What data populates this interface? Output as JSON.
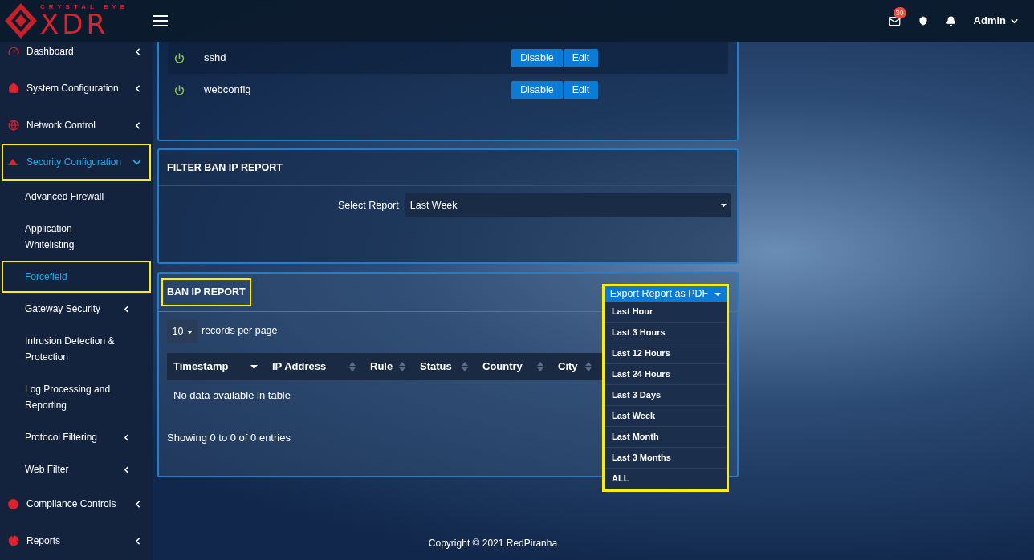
{
  "header": {
    "mail_count": "30",
    "user": "Admin"
  },
  "logo": {
    "tagline": "CRYSTAL EYE",
    "mark": "XDR"
  },
  "sidebar": {
    "items": [
      {
        "label": "Dashboard",
        "kind": "group",
        "expanded": false,
        "selected": false,
        "highlighted": false
      },
      {
        "label": "System Configuration",
        "kind": "group",
        "expanded": false,
        "selected": false,
        "highlighted": false
      },
      {
        "label": "Network Control",
        "kind": "group",
        "expanded": false,
        "selected": false,
        "highlighted": false
      },
      {
        "label": "Security Configuration",
        "kind": "group",
        "expanded": true,
        "selected": true,
        "highlighted": true,
        "children": [
          {
            "label": "Advanced Firewall",
            "kind": "link",
            "selected": false,
            "highlighted": false
          },
          {
            "label": "Application Whitelisting",
            "kind": "link",
            "selected": false,
            "highlighted": false
          },
          {
            "label": "Forcefield",
            "kind": "link",
            "selected": true,
            "highlighted": true
          },
          {
            "label": "Gateway Security",
            "kind": "group",
            "expanded": false,
            "selected": false,
            "highlighted": false
          },
          {
            "label": "Intrusion Detection & Protection",
            "kind": "link",
            "selected": false,
            "highlighted": false
          },
          {
            "label": "Log Processing and Reporting",
            "kind": "link",
            "selected": false,
            "highlighted": false
          },
          {
            "label": "Protocol Filtering",
            "kind": "group",
            "expanded": false,
            "selected": false,
            "highlighted": false
          },
          {
            "label": "Web Filter",
            "kind": "group",
            "expanded": false,
            "selected": false,
            "highlighted": false
          }
        ]
      },
      {
        "label": "Compliance Controls",
        "kind": "group",
        "expanded": false,
        "selected": false,
        "highlighted": false
      },
      {
        "label": "Reports",
        "kind": "group",
        "expanded": false,
        "selected": false,
        "highlighted": false
      }
    ]
  },
  "services": {
    "rows": [
      {
        "name": "sshd",
        "on": true,
        "buttons": [
          "Disable",
          "Edit"
        ]
      },
      {
        "name": "webconfig",
        "on": true,
        "buttons": [
          "Disable",
          "Edit"
        ]
      }
    ]
  },
  "filter": {
    "title": "FILTER BAN IP REPORT",
    "label": "Select Report",
    "value": "Last Week"
  },
  "ban_report": {
    "title": "BAN IP REPORT",
    "highlighted": true,
    "page_size": "10",
    "page_size_label": "records per page",
    "columns": [
      {
        "label": "Timestamp",
        "sorted": true
      },
      {
        "label": "IP Address",
        "sorted": false
      },
      {
        "label": "Rule",
        "sorted": false
      },
      {
        "label": "Status",
        "sorted": false
      },
      {
        "label": "Country",
        "sorted": false
      },
      {
        "label": "City",
        "sorted": false
      }
    ],
    "empty": "No data available in table",
    "info": "Showing 0 to 0 of 0 entries",
    "export": {
      "label": "Export Report as PDF",
      "highlighted": true,
      "expanded": true,
      "options": [
        "Last Hour",
        "Last 3 Hours",
        "Last 12 Hours",
        "Last 24 Hours",
        "Last 3 Days",
        "Last Week",
        "Last Month",
        "Last 3 Months",
        "ALL"
      ]
    }
  },
  "footer": "Copyright © 2021 RedPiranha"
}
